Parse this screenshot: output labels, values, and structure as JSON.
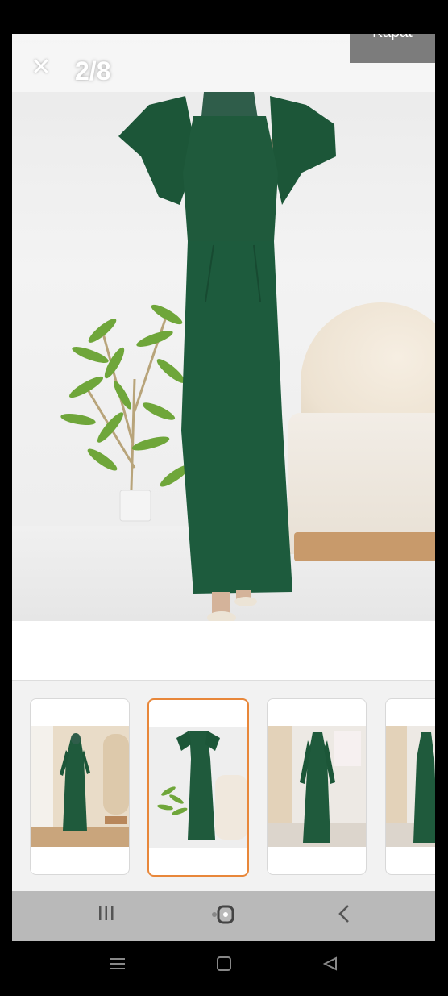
{
  "viewer": {
    "close_symbol": "✕",
    "page_counter": "2/8",
    "close_label": "Kapat"
  },
  "icons": {
    "close": "close-icon",
    "recents": "recents-icon",
    "home": "home-icon",
    "back": "back-icon"
  },
  "product": {
    "dress_color": "#1f5a3c",
    "thumbnail_count": 4,
    "selected_thumbnail_index": 1
  },
  "colors": {
    "accent_border": "#e8873a",
    "kapat_bg": "#7c7c7c"
  }
}
